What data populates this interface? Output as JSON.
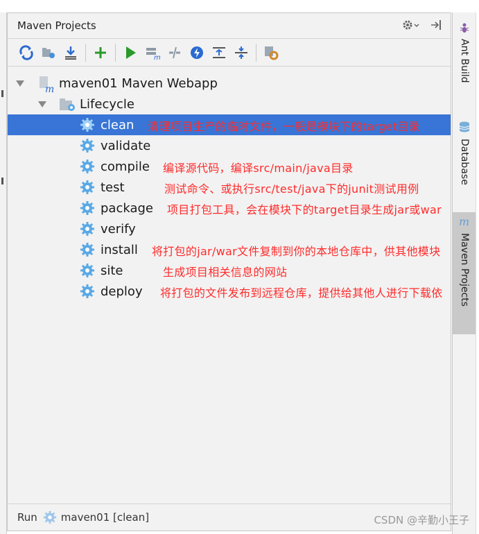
{
  "panel": {
    "title": "Maven Projects"
  },
  "toolbar": {
    "icons": [
      "refresh-icon",
      "generate-sources-icon",
      "download-icon",
      "add-icon",
      "run-icon",
      "execute-goal-icon",
      "toggle-offline-icon",
      "skip-tests-icon",
      "show-dependencies-icon",
      "collapse-all-icon",
      "settings-icon"
    ]
  },
  "tree": {
    "project": "maven01 Maven Webapp",
    "lifecycle": "Lifecycle",
    "phases": [
      {
        "label": "clean",
        "note": "清理项目生产的临时文件，一般是模块下的target目录"
      },
      {
        "label": "validate",
        "note": ""
      },
      {
        "label": "compile",
        "note": "编译源代码，编译src/main/java目录"
      },
      {
        "label": "test",
        "note": "测试命令、或执行src/test/java下的junit测试用例"
      },
      {
        "label": "package",
        "note": "项目打包工具，会在模块下的target目录生成jar或war"
      },
      {
        "label": "verify",
        "note": ""
      },
      {
        "label": "install",
        "note": "将打包的jar/war文件复制到你的本地仓库中，供其他模块"
      },
      {
        "label": "site",
        "note": "生成项目相关信息的网站"
      },
      {
        "label": "deploy",
        "note": "将打包的文件发布到远程仓库，提供给其他人进行下载依"
      }
    ]
  },
  "status": {
    "run_label": "Run",
    "run_target": "maven01 [clean]"
  },
  "sidebar": {
    "tabs": [
      "Ant Build",
      "Database",
      "Maven Projects"
    ]
  },
  "watermark": "CSDN @辛勤小王子",
  "colors": {
    "selection": "#3875d6",
    "annotation": "#ff2b2b",
    "gear": "#5aa9e6"
  }
}
